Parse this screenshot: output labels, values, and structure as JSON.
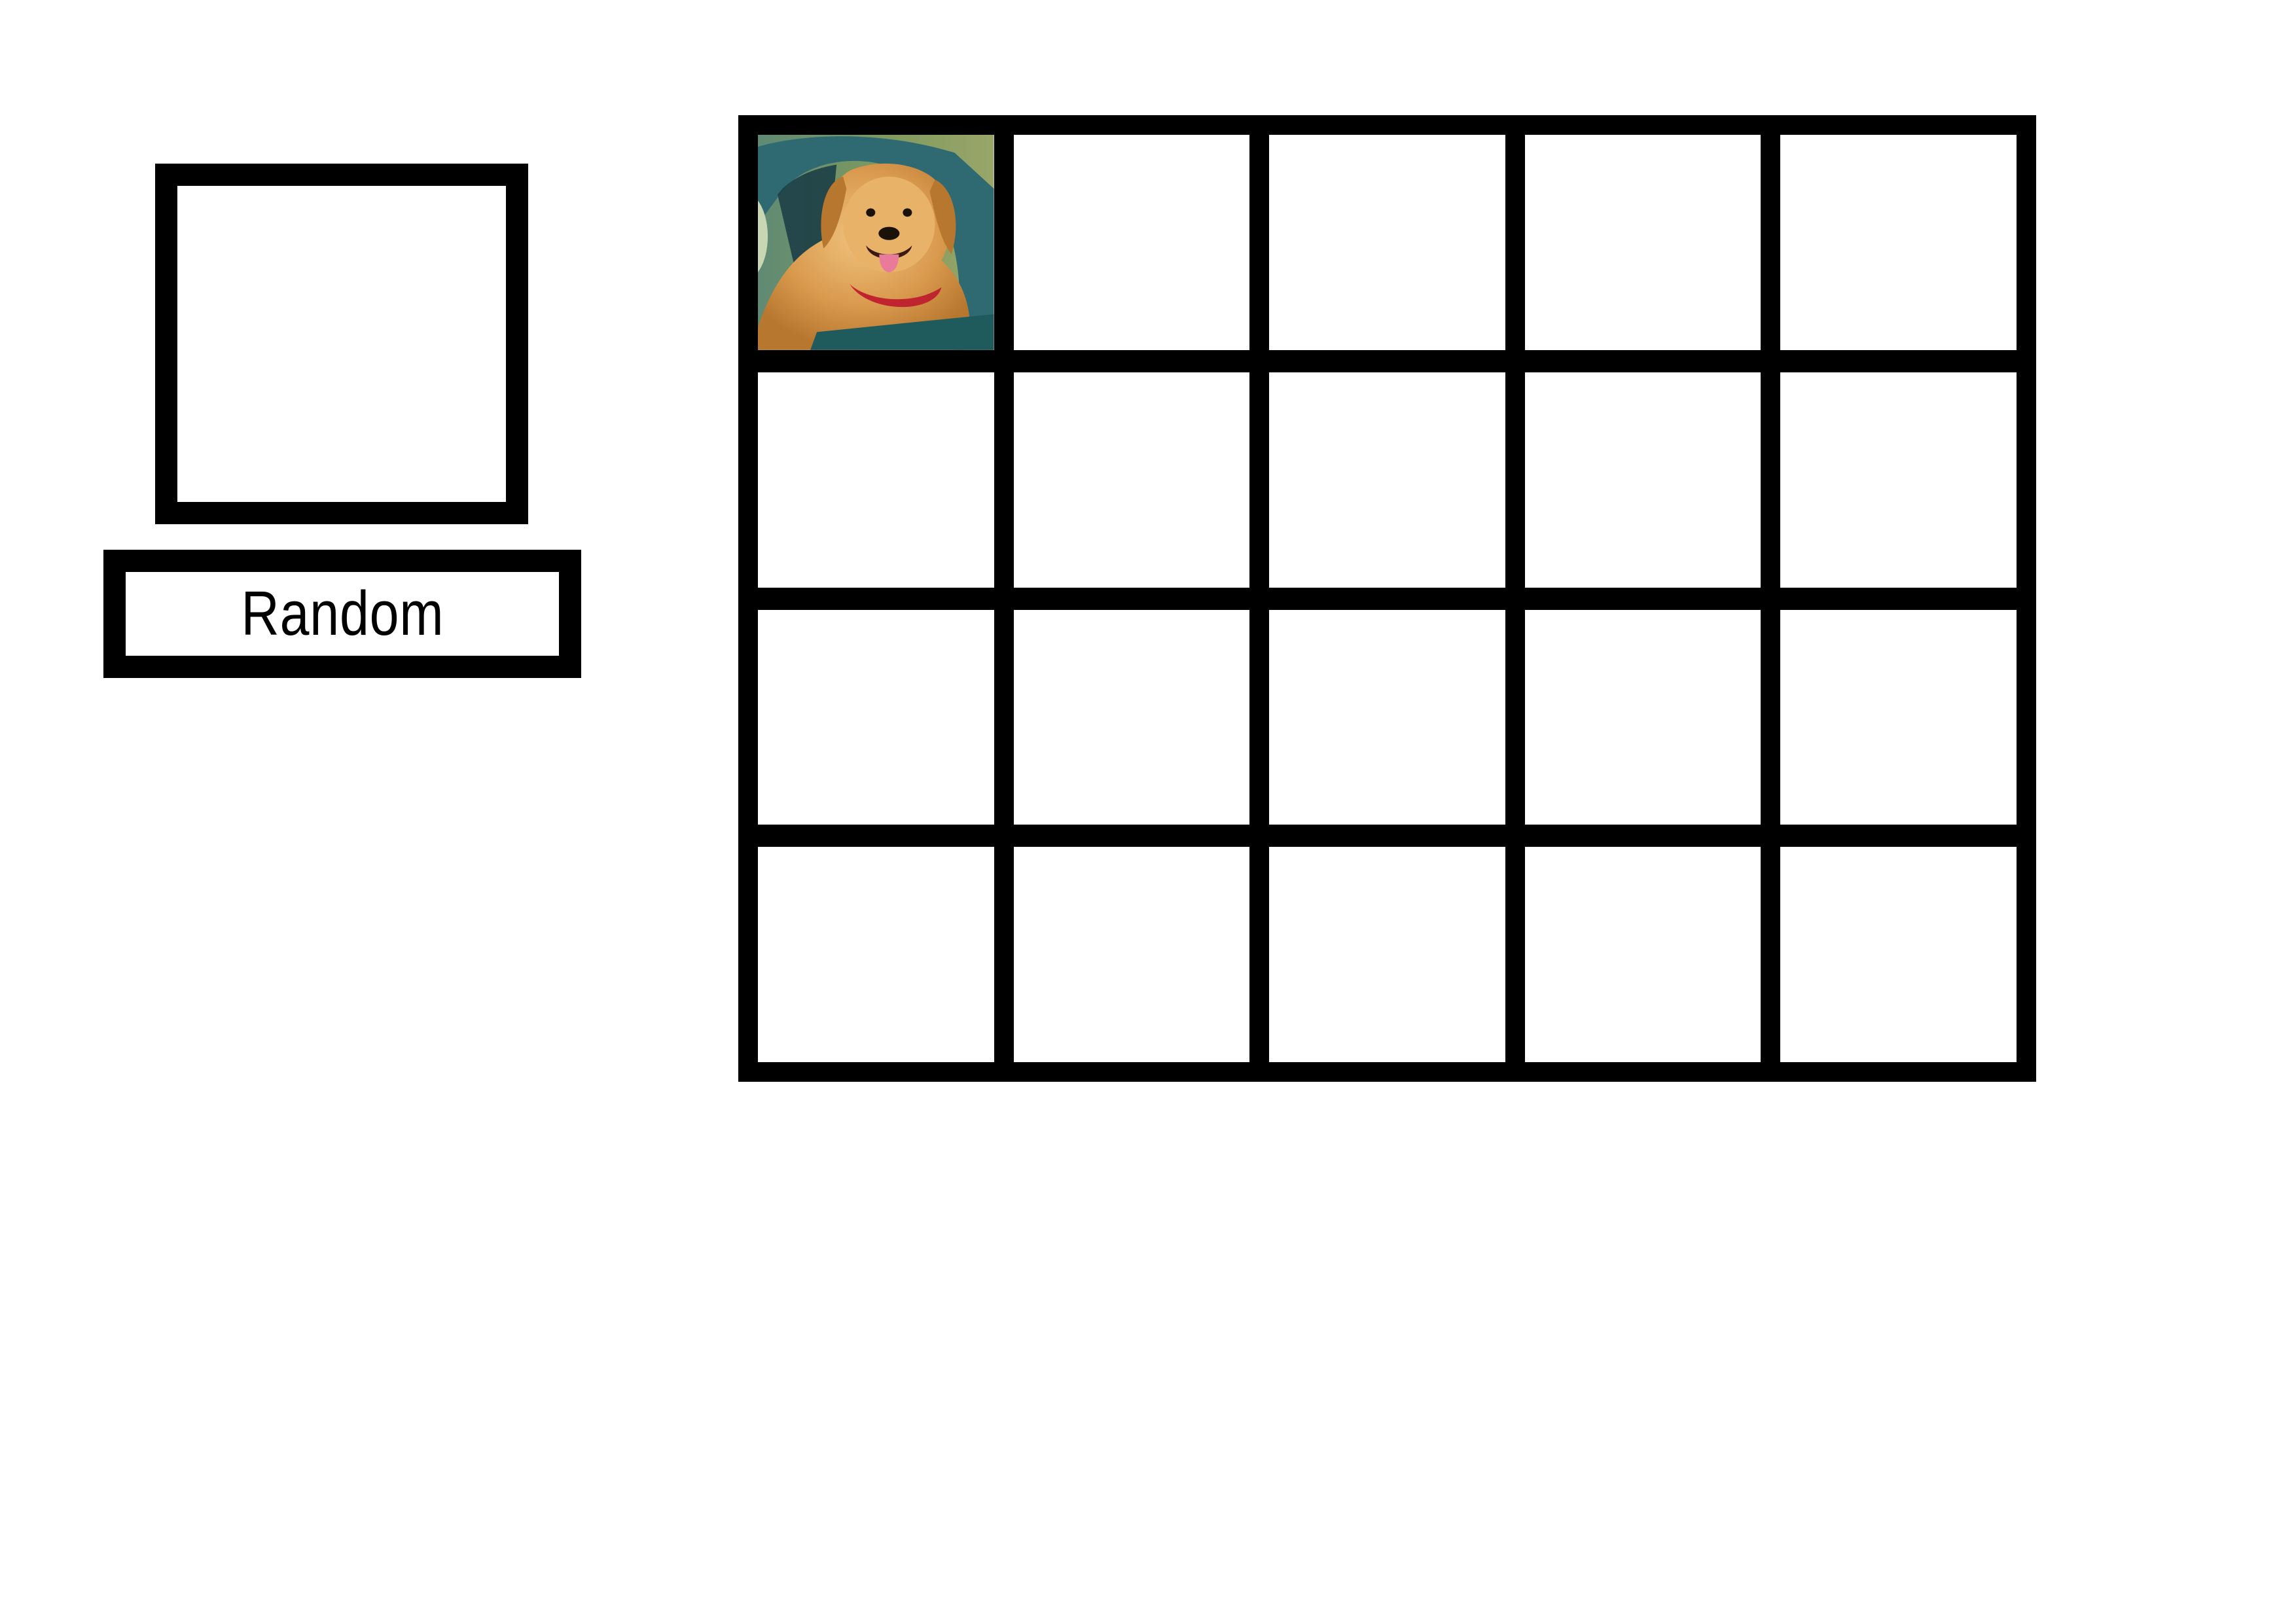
{
  "random_button": {
    "label": "Random"
  },
  "grid": {
    "rows": 4,
    "columns": 5,
    "filled_cell": {
      "row": 1,
      "column": 1,
      "image": "golden-retriever-dog-photo"
    }
  },
  "colors": {
    "border": "#000000",
    "background": "#ffffff"
  }
}
